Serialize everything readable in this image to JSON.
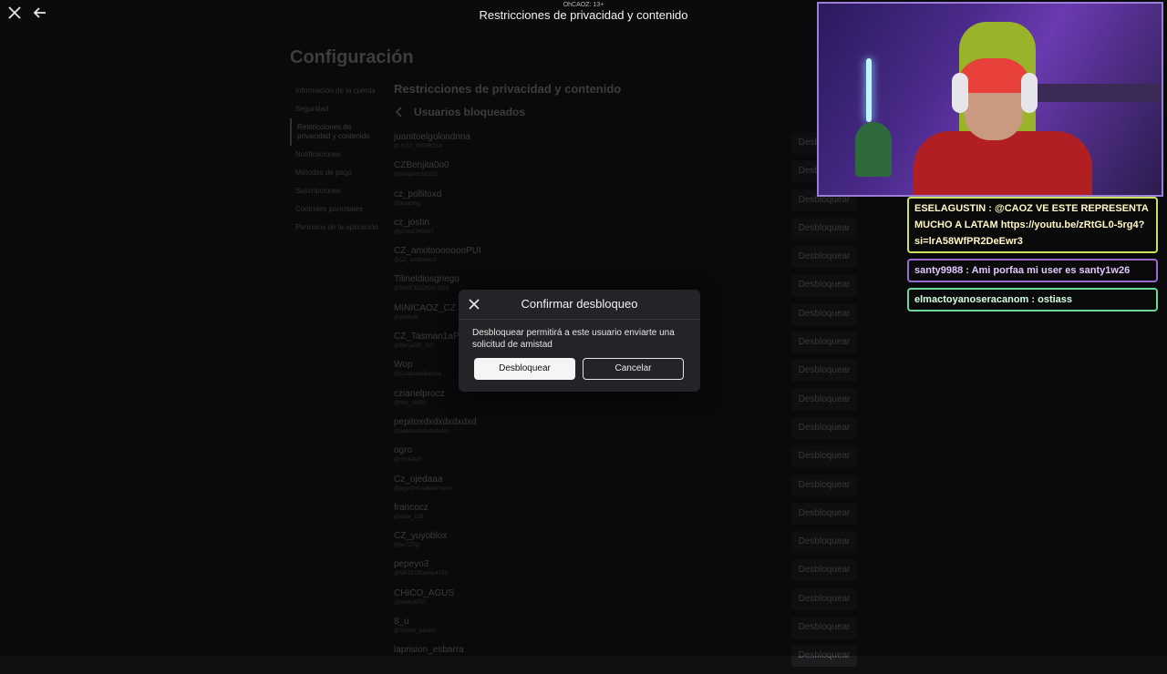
{
  "topbar": {
    "user_tag": "OhCAOZ: 13+",
    "title": "Restricciones de privacidad y contenido"
  },
  "page": {
    "heading": "Configuración",
    "section_title": "Restricciones de privacidad y contenido",
    "subhead": "Usuarios bloqueados"
  },
  "sidebar": {
    "items": [
      {
        "label": "Información de la cuenta"
      },
      {
        "label": "Seguridad"
      },
      {
        "label": "Restricciones de privacidad y contenido"
      },
      {
        "label": "Notificaciones"
      },
      {
        "label": "Métodos de pago"
      },
      {
        "label": "Suscripciones"
      },
      {
        "label": "Controles parentales"
      },
      {
        "label": "Permisos de la aplicación"
      }
    ]
  },
  "blocked_users": [
    {
      "name": "juanitoelgolondrina",
      "handle": "@JUST_PEDRO14",
      "action": "Desbloquear"
    },
    {
      "name": "CZBenjita0o0",
      "handle": "@benja09192925",
      "action": "Desbloquear"
    },
    {
      "name": "cz_pollitoxd",
      "handle": "@tkogutsg",
      "action": "Desbloquear"
    },
    {
      "name": "cz_jostin",
      "handle": "@jostin2345457",
      "action": "Desbloquear"
    },
    {
      "name": "CZ_anxitoooooooPUI",
      "handle": "@CZ_anxitoooo3",
      "action": "Desbloquear"
    },
    {
      "name": "Tilineldiosgriego",
      "handle": "@BARCELONA91003",
      "action": "Desbloquear"
    },
    {
      "name": "MINICAOZ_CZ",
      "handle": "@yAMuI8",
      "action": "Desbloquear"
    },
    {
      "name": "CZ_Tasman1aP",
      "handle": "@BenjaGB_917",
      "action": "Desbloquear"
    },
    {
      "name": "Wop",
      "handle": "@CuadradoBasura",
      "action": "Desbloquear"
    },
    {
      "name": "czianelprocz",
      "handle": "@hilo_16859",
      "action": "Desbloquear"
    },
    {
      "name": "pepitoxdxdxdxdxdxd",
      "handle": "@pepitoxdxdxdxdxdxd",
      "action": "Desbloquear"
    },
    {
      "name": "ogro",
      "handle": "@nocket20",
      "action": "Desbloquear"
    },
    {
      "name": "Cz_ojedaaa",
      "handle": "@agustintuladeunmetro",
      "action": "Desbloquear"
    },
    {
      "name": "francocz",
      "handle": "@keue_636",
      "action": "Desbloquear"
    },
    {
      "name": "CZ_yuyoblox",
      "handle": "@fer727gi",
      "action": "Desbloquear"
    },
    {
      "name": "pepeyo3",
      "handle": "@MATEOGamer4759",
      "action": "Desbloquear"
    },
    {
      "name": "CHICO_AGUS",
      "handle": "@betillo6763",
      "action": "Desbloquear"
    },
    {
      "name": "8_u",
      "handle": "@Tomito_games",
      "action": "Desbloquear"
    },
    {
      "name": "laprision_esbarra",
      "handle": "",
      "action": "Desbloquear"
    }
  ],
  "modal": {
    "title": "Confirmar desbloqueo",
    "body": "Desbloquear permitirá a este usuario enviarte una solicitud de amistad",
    "confirm_label": "Desbloquear",
    "cancel_label": "Cancelar"
  },
  "chat": {
    "messages": [
      {
        "text": "ESELAGUSTIN : @CAOZ VE ESTE REPRESENTA MUCHO A LATAM https://youtu.be/zRtGL0-5rg4?si=lrA58WfPR2DeEwr3",
        "color": "#cfe05a"
      },
      {
        "text": "santy9988 : Ami porfaa mi user es santy1w26",
        "color": "#9a6bd2"
      },
      {
        "text": "elmactoyanoseracanom : ostiass",
        "color": "#6ed69a"
      }
    ]
  },
  "icons": {
    "close": "close-icon",
    "back": "arrow-left-icon",
    "chevron": "chevron-left-icon"
  }
}
